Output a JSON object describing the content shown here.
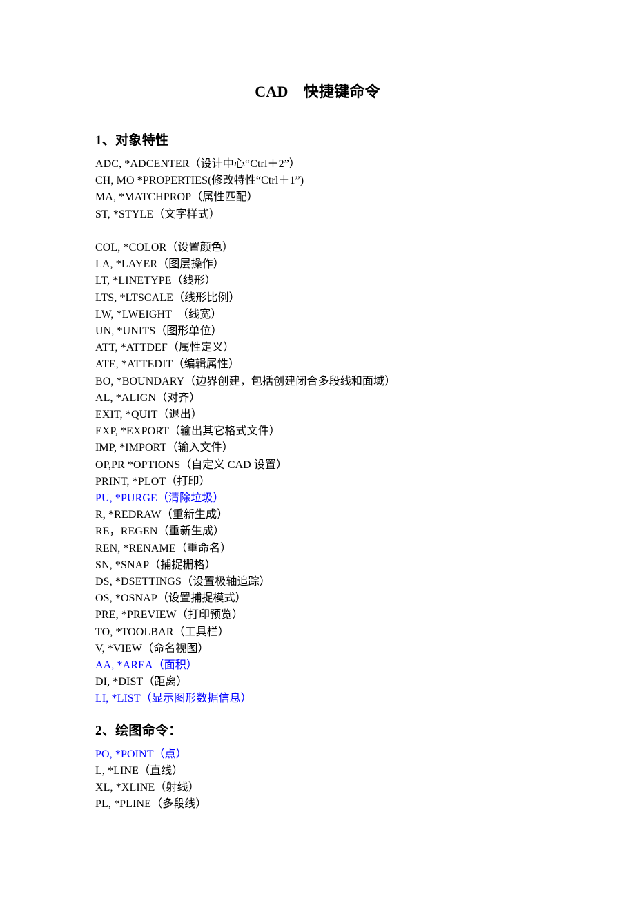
{
  "document": {
    "title": "CAD　快捷键命令",
    "text_color": "#000000",
    "highlight_color": "#0000ff",
    "background_color": "#ffffff"
  },
  "sections": [
    {
      "heading": "1、对象特性",
      "lines": [
        {
          "text": "ADC, *ADCENTER（设计中心“Ctrl＋2”）",
          "color": "black"
        },
        {
          "text": "CH, MO *PROPERTIES(修改特性“Ctrl＋1”)",
          "color": "black"
        },
        {
          "text": "MA, *MATCHPROP（属性匹配）",
          "color": "black"
        },
        {
          "text": "ST, *STYLE（文字样式）",
          "color": "black"
        },
        {
          "text": "",
          "color": "black"
        },
        {
          "text": "COL, *COLOR（设置颜色）",
          "color": "black"
        },
        {
          "text": "LA, *LAYER（图层操作）",
          "color": "black"
        },
        {
          "text": "LT, *LINETYPE（线形）",
          "color": "black"
        },
        {
          "text": "LTS, *LTSCALE（线形比例）",
          "color": "black"
        },
        {
          "text": "LW, *LWEIGHT　（线宽）",
          "color": "black"
        },
        {
          "text": "UN, *UNITS（图形单位）",
          "color": "black"
        },
        {
          "text": "ATT, *ATTDEF（属性定义）",
          "color": "black"
        },
        {
          "text": "ATE, *ATTEDIT（编辑属性）",
          "color": "black"
        },
        {
          "text": "BO, *BOUNDARY（边界创建，包括创建闭合多段线和面域）",
          "color": "black"
        },
        {
          "text": "AL, *ALIGN（对齐）",
          "color": "black"
        },
        {
          "text": "EXIT, *QUIT（退出）",
          "color": "black"
        },
        {
          "text": "EXP, *EXPORT（输出其它格式文件）",
          "color": "black"
        },
        {
          "text": "IMP, *IMPORT（输入文件）",
          "color": "black"
        },
        {
          "text": "OP,PR *OPTIONS（自定义 CAD 设置）",
          "color": "black"
        },
        {
          "text": "PRINT, *PLOT（打印）",
          "color": "black"
        },
        {
          "text": "PU, *PURGE（清除垃圾）",
          "color": "blue"
        },
        {
          "text": "R, *REDRAW（重新生成）",
          "color": "black"
        },
        {
          "text": "RE，REGEN（重新生成）",
          "color": "black"
        },
        {
          "text": "REN, *RENAME（重命名）",
          "color": "black"
        },
        {
          "text": "SN, *SNAP（捕捉栅格）",
          "color": "black"
        },
        {
          "text": "DS, *DSETTINGS（设置极轴追踪）",
          "color": "black"
        },
        {
          "text": "OS, *OSNAP（设置捕捉模式）",
          "color": "black"
        },
        {
          "text": "PRE, *PREVIEW（打印预览）",
          "color": "black"
        },
        {
          "text": "TO, *TOOLBAR（工具栏）",
          "color": "black"
        },
        {
          "text": "V, *VIEW（命名视图）",
          "color": "black"
        },
        {
          "text": "AA, *AREA（面积）",
          "color": "blue"
        },
        {
          "text": "DI, *DIST（距离）",
          "color": "black"
        },
        {
          "text": "LI, *LIST（显示图形数据信息）",
          "color": "blue"
        }
      ]
    },
    {
      "heading": "2、绘图命令：",
      "lines": [
        {
          "text": "PO, *POINT（点）",
          "color": "blue"
        },
        {
          "text": "L, *LINE（直线）",
          "color": "black"
        },
        {
          "text": "XL, *XLINE（射线）",
          "color": "black"
        },
        {
          "text": "PL, *PLINE（多段线）",
          "color": "black"
        }
      ]
    }
  ]
}
